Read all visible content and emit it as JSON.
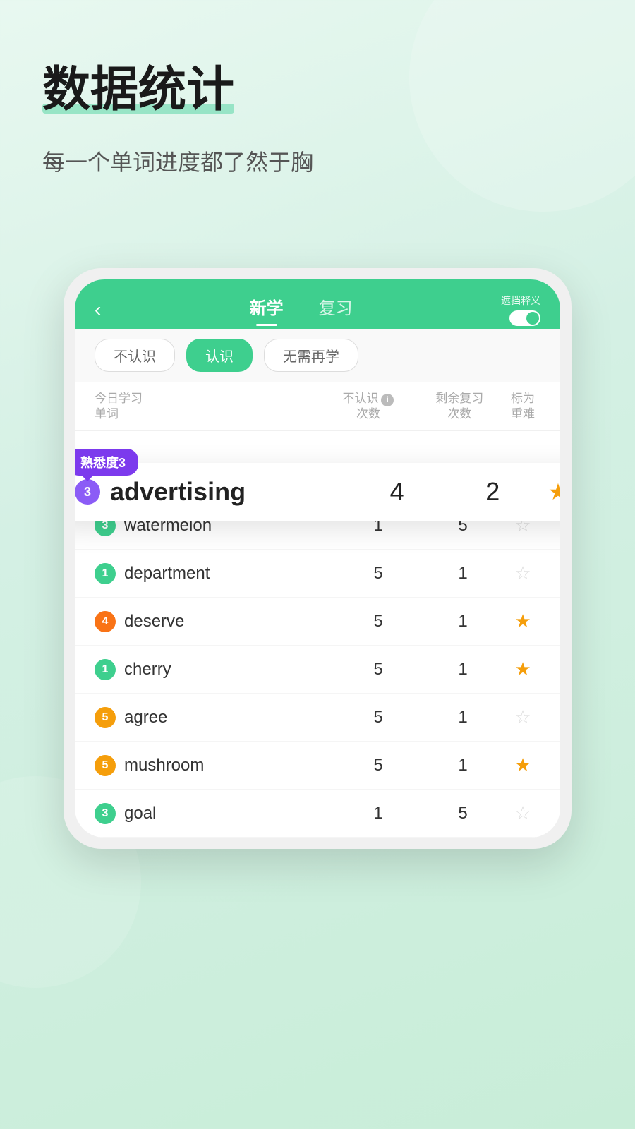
{
  "page": {
    "title": "数据统计",
    "subtitle": "每一个单词进度都了然于胸"
  },
  "phone": {
    "back_btn": "‹",
    "nav": {
      "tabs": [
        {
          "label": "新学",
          "active": true
        },
        {
          "label": "复习",
          "active": false
        }
      ],
      "hint": "遮挡释义"
    },
    "filters": [
      {
        "label": "不认识",
        "active": false
      },
      {
        "label": "认识",
        "active": true
      },
      {
        "label": "无需再学",
        "active": false
      }
    ],
    "table_headers": {
      "col1": "今日学习\n单词",
      "col2_label": "不认识",
      "col2_sub": "次数",
      "col3_label": "剩余复习",
      "col3_sub": "次数",
      "col4": "标为\n重难"
    },
    "featured": {
      "tooltip": "熟悉度3",
      "badge_num": "3",
      "badge_color": "purple",
      "word": "advertising",
      "count1": "4",
      "count2": "2",
      "starred": true
    },
    "words": [
      {
        "badge_num": "3",
        "badge_color": "green",
        "word": "watermelon",
        "count1": "1",
        "count2": "5",
        "starred": false
      },
      {
        "badge_num": "1",
        "badge_color": "green",
        "word": "department",
        "count1": "5",
        "count2": "1",
        "starred": false
      },
      {
        "badge_num": "4",
        "badge_color": "orange",
        "word": "deserve",
        "count1": "5",
        "count2": "1",
        "starred": true
      },
      {
        "badge_num": "1",
        "badge_color": "green",
        "word": "cherry",
        "count1": "5",
        "count2": "1",
        "starred": true
      },
      {
        "badge_num": "5",
        "badge_color": "yellow",
        "word": "agree",
        "count1": "5",
        "count2": "1",
        "starred": false
      },
      {
        "badge_num": "5",
        "badge_color": "yellow",
        "word": "mushroom",
        "count1": "5",
        "count2": "1",
        "starred": true
      },
      {
        "badge_num": "3",
        "badge_color": "green",
        "word": "goal",
        "count1": "1",
        "count2": "5",
        "starred": false
      }
    ]
  }
}
